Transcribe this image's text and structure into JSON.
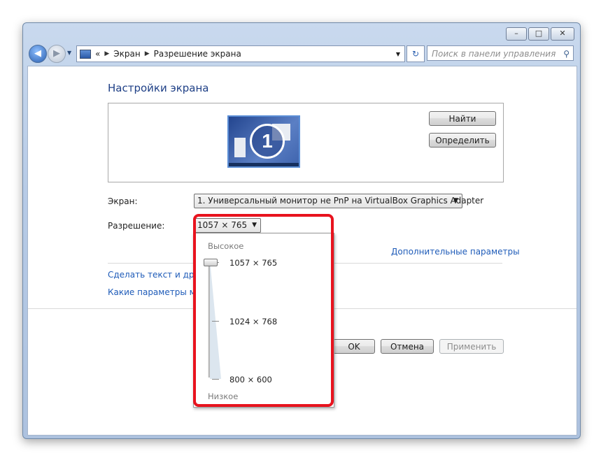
{
  "window": {
    "minimize_label": "–",
    "maximize_label": "□",
    "close_label": "✕"
  },
  "nav": {
    "back_icon": "arrow-left-icon",
    "forward_icon": "arrow-right-icon",
    "breadcrumb": [
      "Экран",
      "Разрешение экрана"
    ],
    "overflow": "«",
    "search_placeholder": "Поиск в панели управления"
  },
  "page": {
    "title": "Настройки экрана",
    "find_label": "Найти",
    "identify_label": "Определить",
    "monitor_number": "1",
    "screen_label": "Экран:",
    "screen_value": "1. Универсальный монитор не PnP на VirtualBox Graphics Adapter",
    "resolution_label": "Разрешение:",
    "resolution_value": "1057 × 765",
    "advanced_link": "Дополнительные параметры",
    "link_text_size": "Сделать текст и други",
    "link_which_params": "Какие параметры мон",
    "ok_label": "OK",
    "cancel_label": "Отмена",
    "apply_label": "Применить"
  },
  "resolution_popup": {
    "high_label": "Высокое",
    "low_label": "Низкое",
    "options": [
      "1057 × 765",
      "1024 × 768",
      "800 × 600"
    ],
    "selected_index": 0
  },
  "colors": {
    "highlight": "#e8131e",
    "title": "#1e3f86",
    "link": "#1e5bb8"
  }
}
